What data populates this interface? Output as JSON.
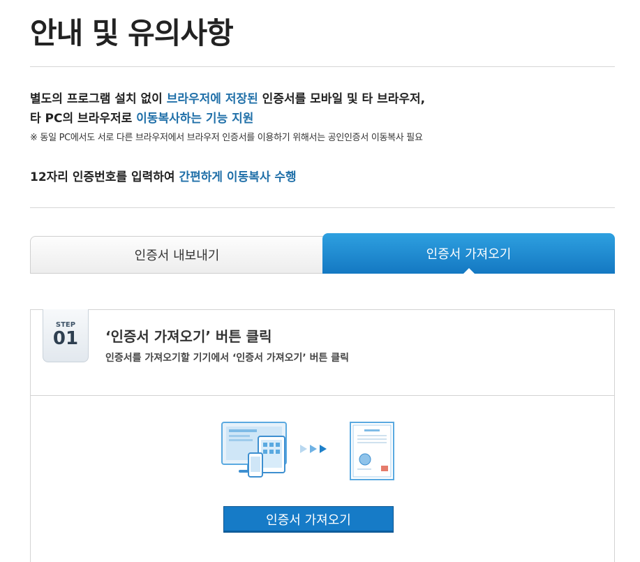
{
  "header": {
    "title": "안내 및 유의사항"
  },
  "intro": {
    "line1_a": "별도의 프로그램 설치 없이 ",
    "line1_b": "브라우저에 저장된",
    "line1_c": " 인증서를 모바일 및 타 브라우저,",
    "line2_a": "타 PC의 브라우저로 ",
    "line2_b": "이동복사하는 기능 지원",
    "note": "※ 동일 PC에서도 서로 다른 브라우저에서 브라우저 인증서를 이용하기 위해서는 공인인증서 이동복사 필요",
    "line3_a": "12자리 인증번호를 입력하여 ",
    "line3_b": "간편하게 이동복사 수행"
  },
  "tabs": [
    {
      "label": "인증서 내보내기",
      "active": false
    },
    {
      "label": "인증서 가져오기",
      "active": true
    }
  ],
  "step": {
    "label": "STEP",
    "number": "01",
    "title": "‘인증서 가져오기’ 버튼 클릭",
    "desc": "인증서를 가져오기할 기기에서 ‘인증서 가져오기’ 버튼 클릭"
  },
  "action_button": {
    "label": "인증서 가져오기"
  },
  "colors": {
    "accent": "#1478c2",
    "highlight_text": "#1f6fa8"
  },
  "icons": [
    "devices-icon",
    "arrow-right-icon",
    "certificate-icon"
  ]
}
